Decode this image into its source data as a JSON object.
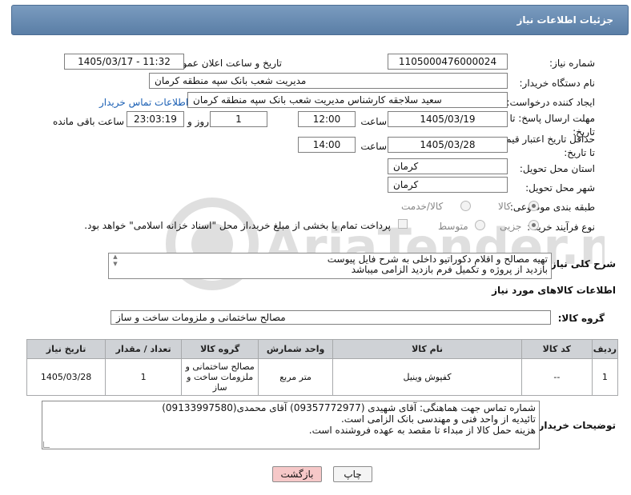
{
  "header": {
    "title": "جزئیات اطلاعات نیاز"
  },
  "fields": {
    "need_number_label": "شماره نیاز:",
    "need_number": "1105000476000024",
    "announce_label": "تاریخ و ساعت اعلان عمومی:",
    "announce_value": "1405/03/17 - 11:32",
    "buyer_org_label": "نام دستگاه خریدار:",
    "buyer_org": "مدیریت شعب بانک سپه منطقه کرمان",
    "requester_label": "ایجاد کننده درخواست:",
    "requester": "سعید سلاجقه کارشناس مدیریت شعب بانک سپه منطقه کرمان",
    "buyer_contact_link": "اطلاعات تماس خریدار",
    "reply_deadline_label": "مهلت ارسال پاسخ: تا تاریخ:",
    "reply_date": "1405/03/19",
    "time_label": "ساعت",
    "reply_time": "12:00",
    "days_value": "1",
    "days_label": "روز و",
    "remaining_time": "23:03:19",
    "remaining_label": "ساعت باقی مانده",
    "price_valid_label": "حداقل تاریخ اعتبار قیمت: تا تاریخ:",
    "price_valid_date": "1405/03/28",
    "price_valid_time": "14:00",
    "province_label": "استان محل تحویل:",
    "province": "کرمان",
    "city_label": "شهر محل تحویل:",
    "city": "کرمان",
    "category_label": "طبقه بندی موضوعی:",
    "category_options": [
      "کالا",
      "کالا/خدمت"
    ],
    "process_label": "نوع فرآیند خرید :",
    "process_options": [
      "جزیی",
      "متوسط"
    ],
    "payment_note": "پرداخت تمام یا بخشی از مبلغ خرید،از محل \"اسناد خزانه اسلامی\" خواهد بود.",
    "description_label": "شرح کلی نیاز:",
    "description": "تهیه مصالح و اقلام دکوراتیو داخلی به شرح فایل پیوست\nبازدید از پروژه و تکمیل فرم بازدید الزامی میباشد"
  },
  "goods": {
    "section_title": "اطلاعات کالاهای مورد نیاز",
    "group_label": "گروه کالا:",
    "group_value": "مصالح ساختمانی و ملزومات ساخت و ساز",
    "columns": [
      "ردیف",
      "کد کالا",
      "نام کالا",
      "واحد شمارش",
      "گروه کالا",
      "تعداد / مقدار",
      "تاریخ نیاز"
    ],
    "rows": [
      {
        "row": "1",
        "code": "--",
        "name": "کفپوش وینیل",
        "unit": "متر مربع",
        "group": "مصالح ساختمانی و ملزومات ساخت و ساز",
        "qty": "1",
        "date": "1405/03/28"
      }
    ]
  },
  "buyer_notes": {
    "label": "توضیحات خریدار:",
    "text": "شماره تماس جهت هماهنگی: آقای شهیدی (09357772977) آقای محمدی(09133997580)\nتائیدیه از واحد فنی و مهندسی بانک الزامی است.\nهزینه حمل کالا از مبداء تا مقصد به عهده فروشنده است."
  },
  "buttons": {
    "print": "چاپ",
    "back": "بازگشت"
  },
  "watermark": {
    "brand": "AriaTender.neT"
  },
  "colors": {
    "title_bar": "#5a7ea6",
    "link": "#1a5fb4",
    "back_button": "#f6c8c8",
    "table_header": "#cfd2d6"
  }
}
